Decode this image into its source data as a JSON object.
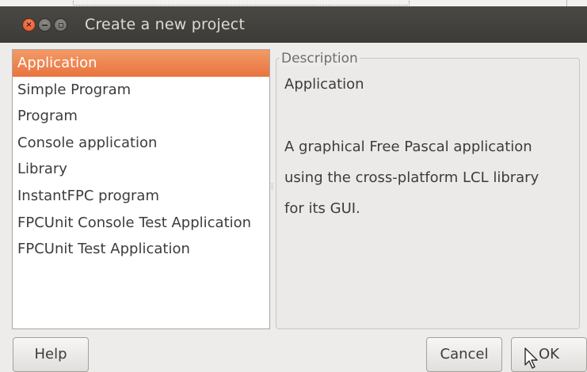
{
  "window": {
    "title": "Create a new project"
  },
  "project_list": {
    "selected_index": 0,
    "items": [
      "Application",
      "Simple Program",
      "Program",
      "Console application",
      "Library",
      "InstantFPC program",
      "FPCUnit Console Test Application",
      "FPCUnit Test Application"
    ]
  },
  "description": {
    "legend": "Description",
    "title": "Application",
    "body_lines": [
      "A graphical Free Pascal application",
      "using the cross-platform LCL library",
      "for its GUI."
    ]
  },
  "buttons": {
    "help": "Help",
    "cancel": "Cancel",
    "ok": "OK"
  },
  "colors": {
    "titlebar": "#3c3b37",
    "selection": "#f07746",
    "close_button": "#e95420"
  }
}
